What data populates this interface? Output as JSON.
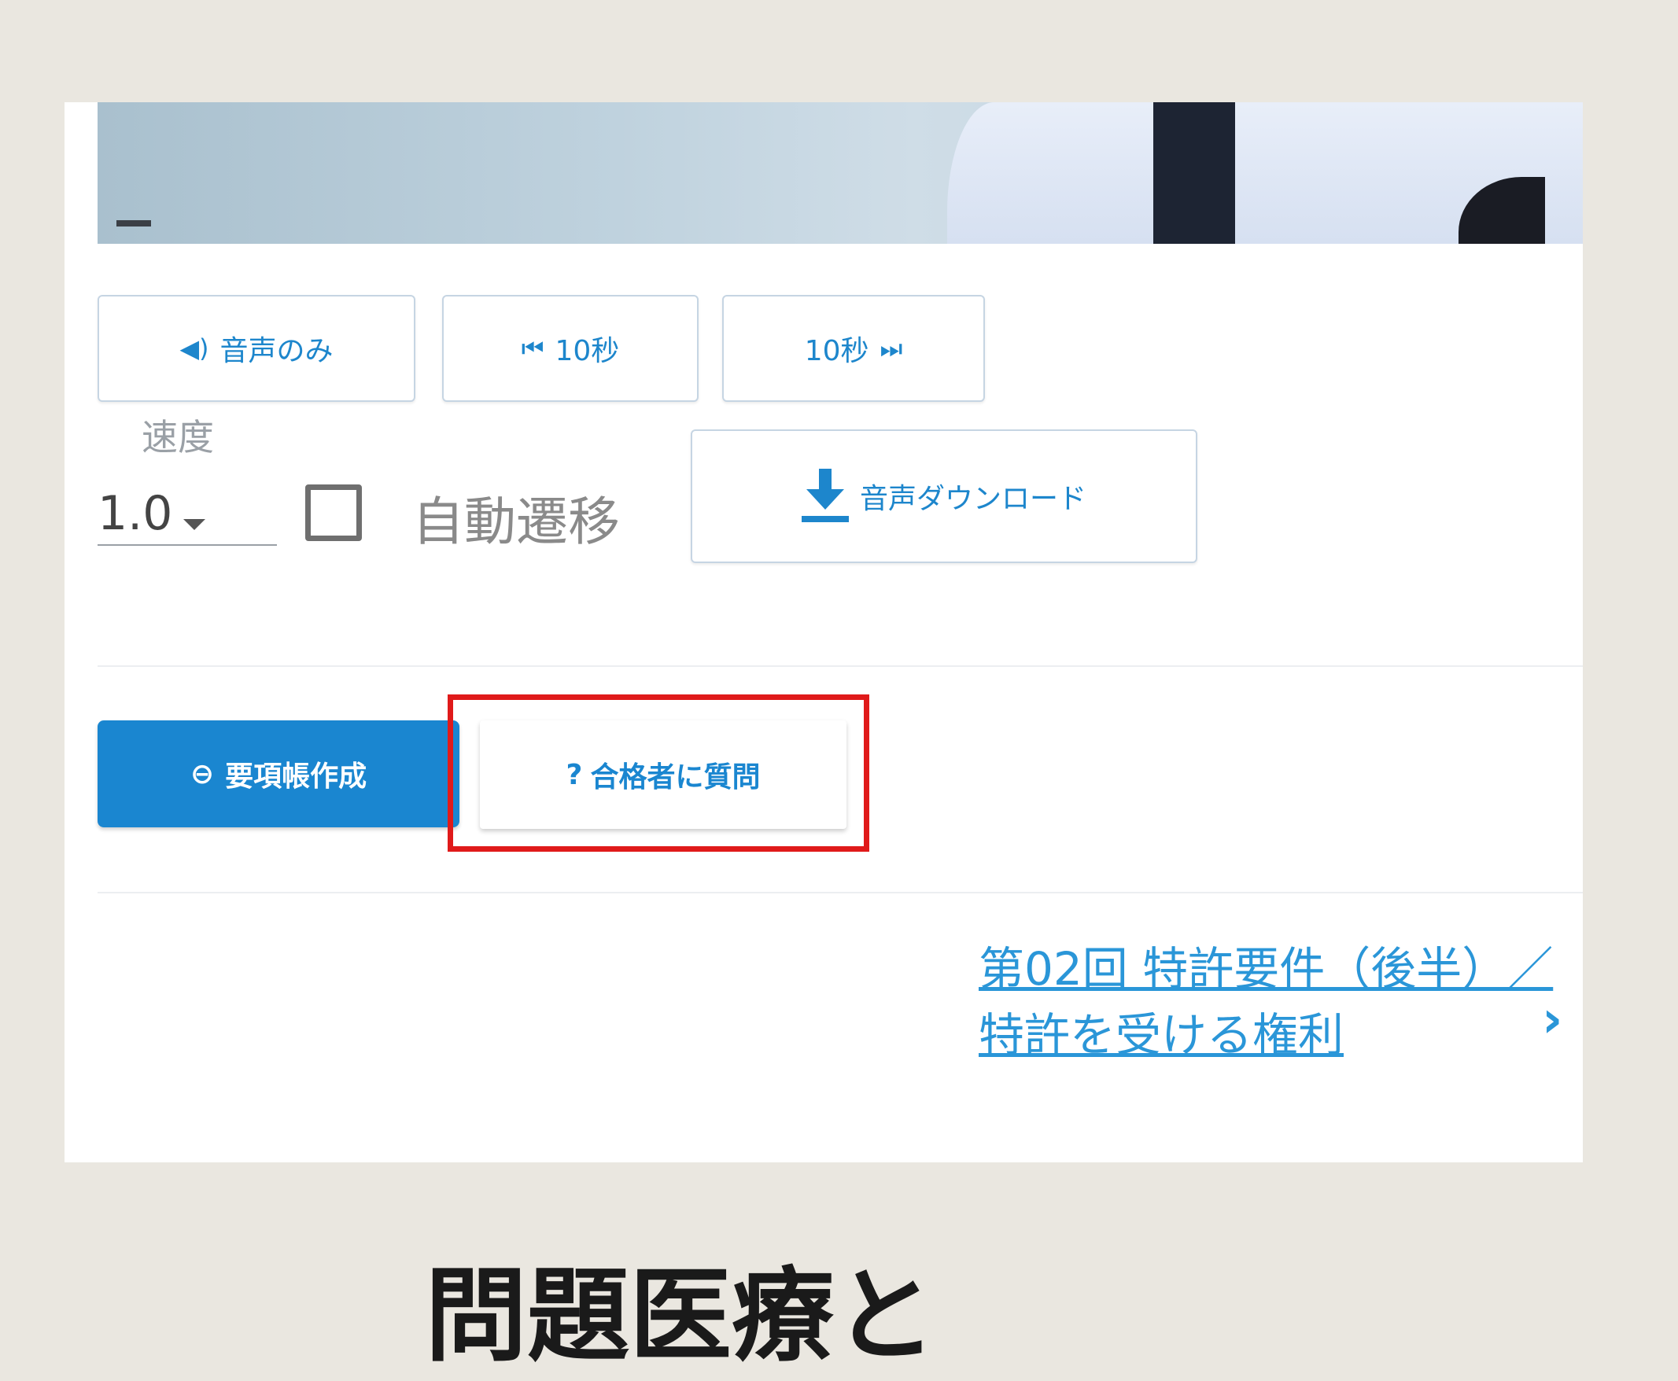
{
  "colors": {
    "page_background": "#eae7e0",
    "primary_blue": "#1a86d0",
    "link_blue": "#2a96d8",
    "highlight_red": "#e01a1a"
  },
  "player_controls": {
    "audio_only": {
      "icon": "speaker-icon",
      "icon_glyph": "◀)",
      "label": "音声のみ"
    },
    "rewind": {
      "icon": "skip-back-icon",
      "icon_glyph": "⏮",
      "label": "10秒"
    },
    "forward": {
      "icon": "skip-forward-icon",
      "icon_glyph": "⏭",
      "label": "10秒"
    },
    "download_audio": {
      "icon": "download-icon",
      "label": "音声ダウンロード"
    }
  },
  "speed": {
    "label": "速度",
    "selected": "1.0"
  },
  "auto_advance": {
    "label": "自動遷移",
    "checked": false
  },
  "actions": {
    "create_note": {
      "icon": "note-icon",
      "icon_glyph": "⊖",
      "label": "要項帳作成"
    },
    "ask_passer": {
      "icon": "question-icon",
      "icon_glyph": "?",
      "label": "合格者に質問"
    }
  },
  "next_lesson": {
    "link_text": "第02回 特許要件（後半）／特許を受ける権利",
    "chevron": "›"
  },
  "footer_partial_text": "問題医療と"
}
